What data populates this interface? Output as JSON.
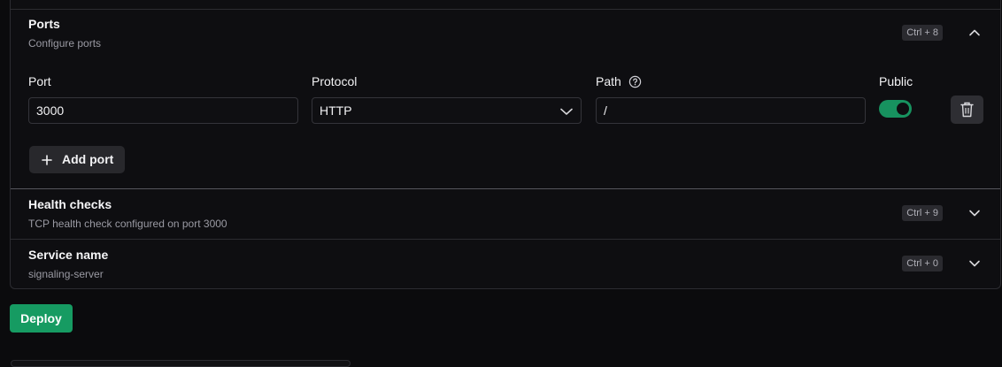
{
  "sections": {
    "ports": {
      "title": "Ports",
      "subtitle": "Configure ports",
      "shortcut": "Ctrl + 8",
      "expanded": true,
      "fields": {
        "port_label": "Port",
        "protocol_label": "Protocol",
        "path_label": "Path",
        "public_label": "Public",
        "port_value": "3000",
        "protocol_value": "HTTP",
        "path_value": "/",
        "public_enabled": true
      },
      "add_port_label": "Add port"
    },
    "health_checks": {
      "title": "Health checks",
      "subtitle": "TCP health check configured on port 3000",
      "shortcut": "Ctrl + 9",
      "expanded": false
    },
    "service_name": {
      "title": "Service name",
      "subtitle": "signaling-server",
      "shortcut": "Ctrl + 0",
      "expanded": false
    }
  },
  "deploy_label": "Deploy",
  "colors": {
    "accent": "#169b62",
    "toggle_on": "#17925f",
    "background": "#0b0b0d"
  },
  "icons": [
    "chevron-up-icon",
    "chevron-down-icon",
    "help-circle-icon",
    "trash-icon",
    "plus-icon"
  ]
}
